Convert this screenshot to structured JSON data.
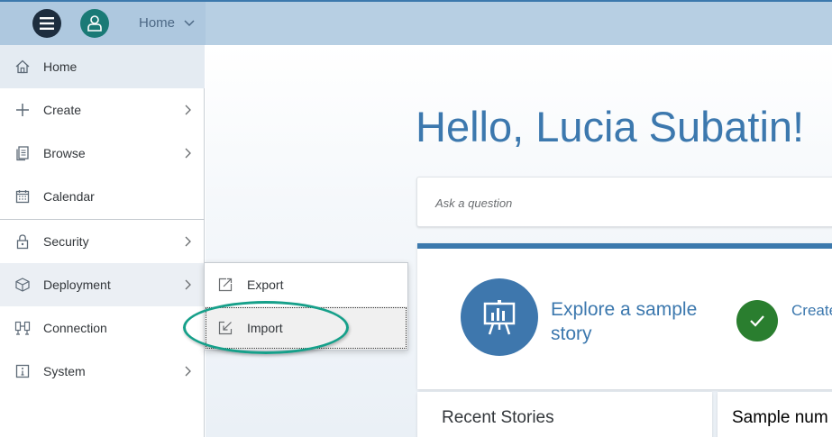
{
  "shell": {
    "home_label": "Home"
  },
  "nav": {
    "items": [
      {
        "label": "Home"
      },
      {
        "label": "Create"
      },
      {
        "label": "Browse"
      },
      {
        "label": "Calendar"
      },
      {
        "label": "Security"
      },
      {
        "label": "Deployment"
      },
      {
        "label": "Connection"
      },
      {
        "label": "System"
      }
    ]
  },
  "submenu": {
    "items": [
      {
        "label": "Export"
      },
      {
        "label": "Import"
      }
    ]
  },
  "main": {
    "greeting": "Hello, Lucia Subatin!",
    "ask_placeholder": "Ask a question",
    "explore_label": "Explore a sample story",
    "create_label": "Create accou",
    "recent_title": "Recent Stories",
    "sample_title": "Sample num"
  },
  "colors": {
    "accent": "#3c79ad",
    "shell_bg": "#b7cfe3",
    "teal_highlight": "#16a08a",
    "success": "#2a7e2f"
  }
}
